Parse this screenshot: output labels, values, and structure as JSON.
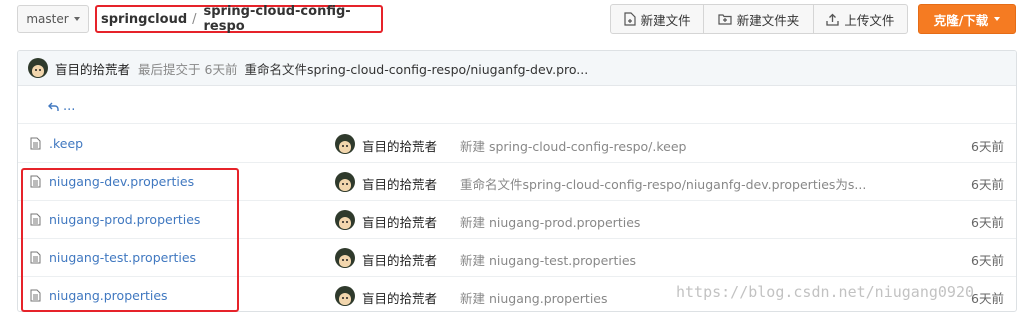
{
  "toolbar": {
    "branch": "master",
    "breadcrumb": {
      "owner": "springcloud",
      "separator": "/",
      "repo": "spring-cloud-config-respo"
    },
    "new_file": "新建文件",
    "new_folder": "新建文件夹",
    "upload": "上传文件",
    "clone": "克隆/下载"
  },
  "last_commit": {
    "author": "盲目的拾荒者",
    "meta": "最后提交于 6天前",
    "message": "重命名文件spring-cloud-config-respo/niuganfg-dev.pro..."
  },
  "back_label": "...",
  "files": [
    {
      "name": ".keep",
      "author": "盲目的拾荒者",
      "message": "新建 spring-cloud-config-respo/.keep",
      "time": "6天前"
    },
    {
      "name": "niugang-dev.properties",
      "author": "盲目的拾荒者",
      "message": "重命名文件spring-cloud-config-respo/niuganfg-dev.properties为s...",
      "time": "6天前"
    },
    {
      "name": "niugang-prod.properties",
      "author": "盲目的拾荒者",
      "message": "新建 niugang-prod.properties",
      "time": "6天前"
    },
    {
      "name": "niugang-test.properties",
      "author": "盲目的拾荒者",
      "message": "新建 niugang-test.properties",
      "time": "6天前"
    },
    {
      "name": "niugang.properties",
      "author": "盲目的拾荒者",
      "message": "新建 niugang.properties",
      "time": "6天前"
    }
  ],
  "watermark": "https://blog.csdn.net/niugang0920",
  "colors": {
    "accent": "#f57b22",
    "link": "#4078c0",
    "annotation": "#e6232a"
  }
}
